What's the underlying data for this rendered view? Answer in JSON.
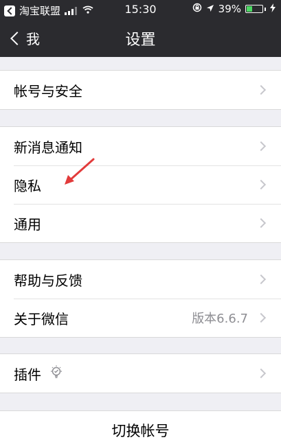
{
  "status_bar": {
    "carrier": "淘宝联盟",
    "time": "15:30",
    "battery": "39%",
    "battery_level": 0.39,
    "battery_color": "#4cd964"
  },
  "nav": {
    "back_label": "我",
    "title": "设置"
  },
  "groups": [
    {
      "items": [
        {
          "label": "帐号与安全"
        }
      ]
    },
    {
      "items": [
        {
          "label": "新消息通知"
        },
        {
          "label": "隐私"
        },
        {
          "label": "通用"
        }
      ]
    },
    {
      "items": [
        {
          "label": "帮助与反馈"
        },
        {
          "label": "关于微信",
          "value": "版本6.6.7"
        }
      ]
    },
    {
      "items": [
        {
          "label": "插件",
          "icon": "plugin-icon"
        }
      ]
    }
  ],
  "switch_account": {
    "label": "切换帐号"
  },
  "colors": {
    "header_bg": "#2b2b2f",
    "page_bg": "#efeff4",
    "annotation_arrow": "#e23b3b"
  },
  "icons": {
    "back_app": "back-to-app-icon",
    "signal": "signal-icon",
    "wifi": "wifi-icon",
    "orientation_lock": "orientation-lock-icon",
    "location": "location-arrow-icon",
    "battery": "battery-icon",
    "charging": "charging-bolt-icon",
    "back": "chevron-left-icon",
    "disclosure": "chevron-right-icon",
    "plugin": "plugin-bulb-icon",
    "annotation": "annotation-arrow-icon"
  }
}
